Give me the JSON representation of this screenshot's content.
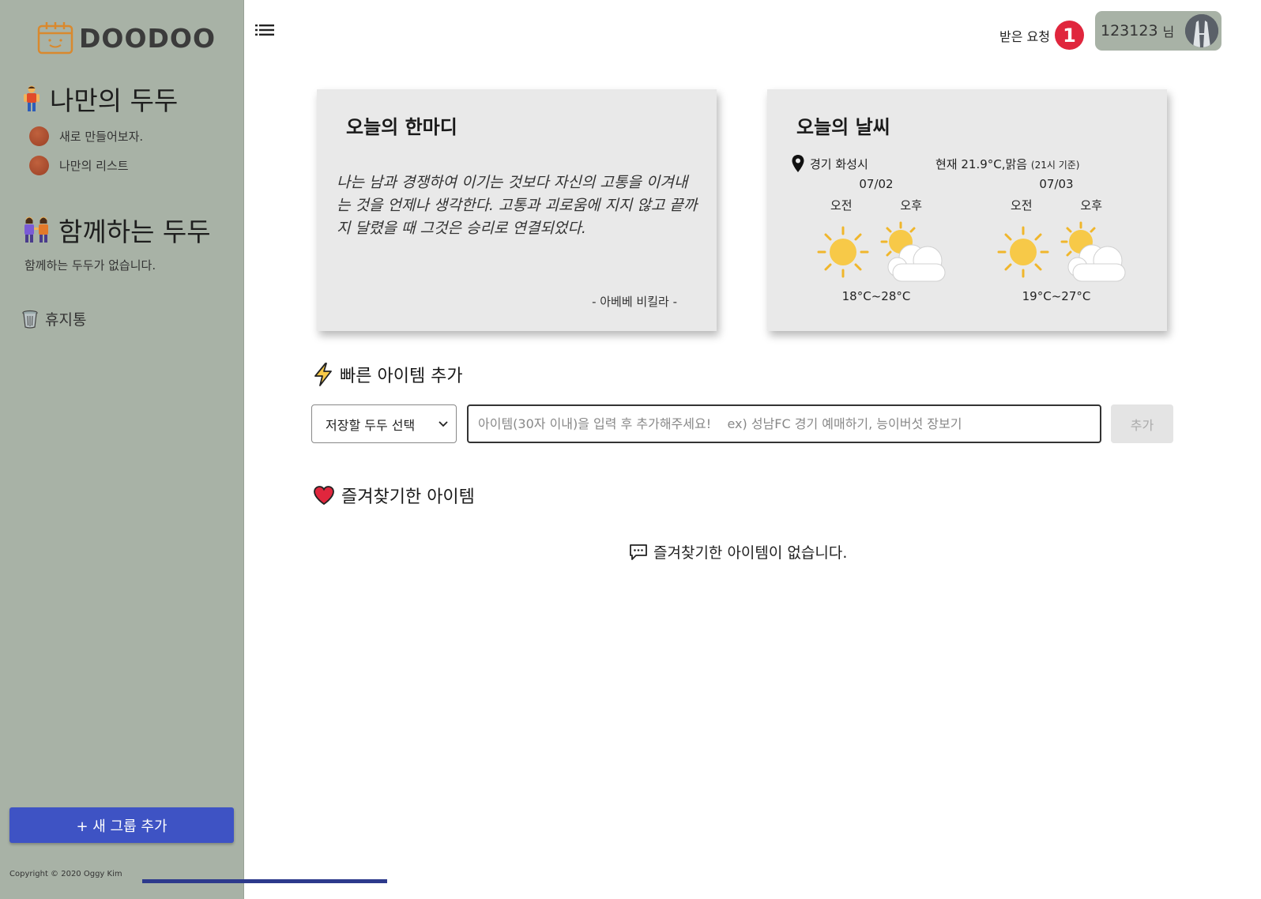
{
  "sidebar": {
    "logo_text": "DOODOO",
    "my_section_title": "나만의 두두",
    "my_items": [
      {
        "label": "새로 만들어보자."
      },
      {
        "label": "나만의 리스트"
      }
    ],
    "shared_section_title": "함께하는 두두",
    "shared_empty": "함께하는 두두가 없습니다.",
    "trash_label": "휴지통",
    "add_group_label": "+ 새 그룹 추가",
    "copyright": "Copyright © 2020 Oggy Kim",
    "bg_color": "#a8b2a6",
    "button_color": "#3e53c4"
  },
  "header": {
    "requests_label": "받은 요청",
    "requests_count": "1",
    "user_name": "123123",
    "user_suffix": "님",
    "badge_color": "#e0263d"
  },
  "quote": {
    "title": "오늘의 한마디",
    "text": "나는 남과 경쟁하여 이기는 것보다 자신의 고통을 이겨내는 것을 언제나 생각한다. 고통과 괴로움에 지지 않고 끝까지 달렸을 때 그것은 승리로 연결되었다.",
    "author": "- 아베베 비킬라 -"
  },
  "weather": {
    "title": "오늘의 날씨",
    "location": "경기 화성시",
    "current": "현재 21.9°C,맑음",
    "current_note": "(21시 기준)",
    "days": [
      {
        "date": "07/02",
        "am": "오전",
        "pm": "오후",
        "am_icon": "sun-icon",
        "pm_icon": "partly-cloudy-icon",
        "temp": "18°C~28°C"
      },
      {
        "date": "07/03",
        "am": "오전",
        "pm": "오후",
        "am_icon": "sun-icon",
        "pm_icon": "partly-cloudy-icon",
        "temp": "19°C~27°C"
      }
    ]
  },
  "quick_add": {
    "title": "빠른 아이템 추가",
    "select_label": "저장할 두두 선택",
    "input_placeholder": "아이템(30자 이내)을 입력 후 추가해주세요!    ex) 성남FC 경기 예매하기, 능이버섯 장보기",
    "add_label": "추가"
  },
  "favorites": {
    "title": "즐겨찾기한 아이템",
    "empty": "즐겨찾기한 아이템이 없습니다."
  }
}
